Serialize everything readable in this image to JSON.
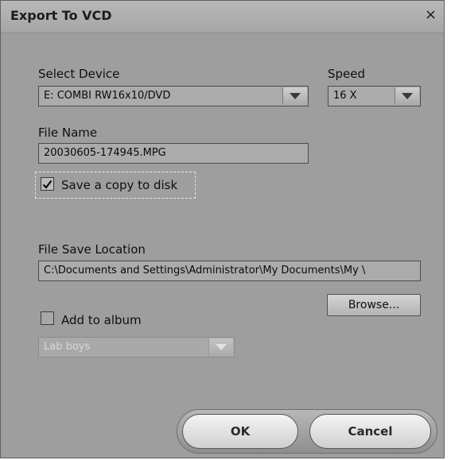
{
  "dialog": {
    "title": "Export To VCD",
    "close_glyph": "×"
  },
  "device": {
    "label": "Select Device",
    "value": "E: COMBI RW16x10/DVD"
  },
  "speed": {
    "label": "Speed",
    "value": "16 X"
  },
  "file_name": {
    "label": "File Name",
    "value": "20030605-174945.MPG"
  },
  "save_copy": {
    "label": "Save a copy to disk",
    "checked": true
  },
  "save_location": {
    "label": "File Save Location",
    "value": "C:\\Documents and Settings\\Administrator\\My Documents\\My \\"
  },
  "browse": {
    "label": "Browse..."
  },
  "album": {
    "label": "Add to album",
    "checked": false,
    "value": "Lab boys",
    "enabled": false
  },
  "buttons": {
    "ok": "OK",
    "cancel": "Cancel"
  },
  "icons": {
    "close": "close-icon",
    "dropdown": "chevron-down-icon",
    "check": "checkmark-icon"
  }
}
